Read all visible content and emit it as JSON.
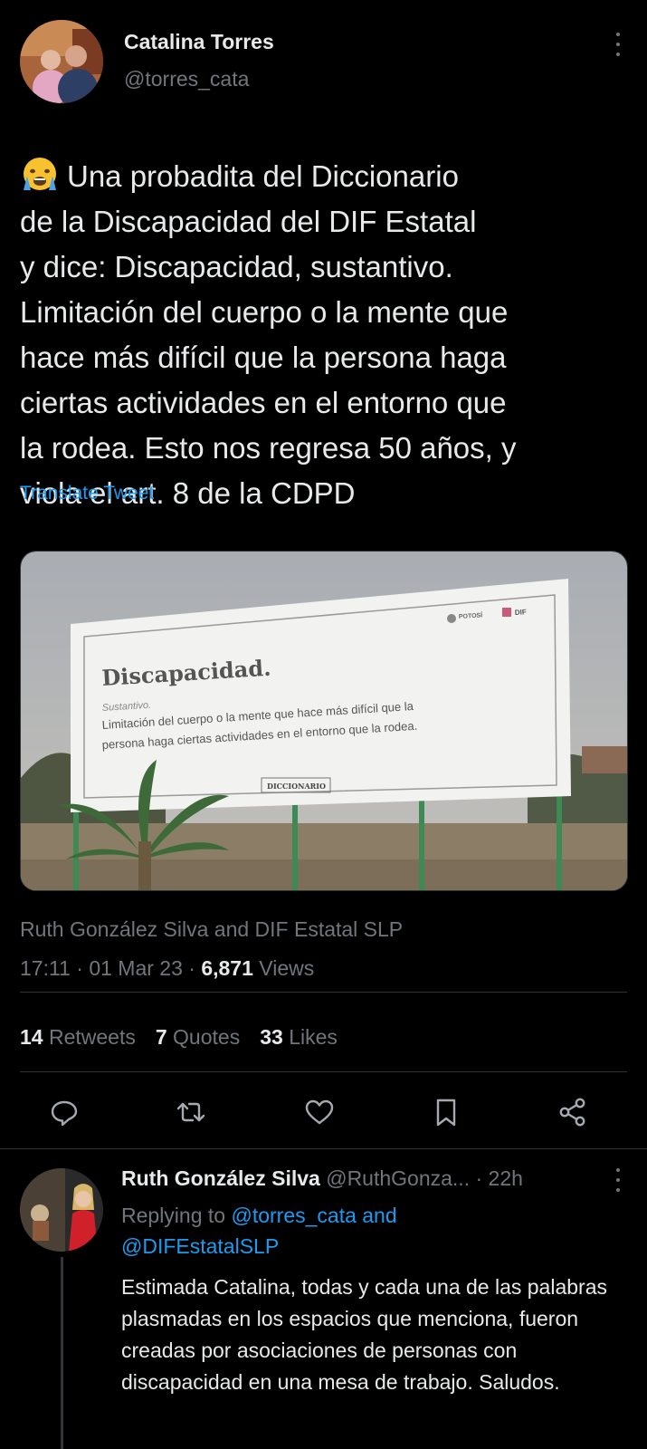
{
  "tweet": {
    "author_name": "Catalina Torres",
    "author_handle": "@torres_cata",
    "text": "Una probadita del Diccionario\nde la Discapacidad del DIF Estatal\ny dice: Discapacidad, sustantivo.\nLimitación del cuerpo o la mente que\nhace más difícil que la persona haga\nciertas actividades en el entorno que\nla rodea.  Esto nos regresa 50 años, y\nviola el art. 8 de la CDPD",
    "translate_label": "Translate Tweet",
    "media": {
      "billboard_title": "Discapacidad.",
      "billboard_pos": "Sustantivo.",
      "billboard_line1": "Limitación del cuerpo o la mente que hace más difícil que la",
      "billboard_line2": "persona haga ciertas actividades en el entorno que la rodea.",
      "billboard_logo1": "POTOSÍ",
      "billboard_logo2": "DIF",
      "billboard_footer": "DICCIONARIO"
    },
    "tagged": "Ruth González Silva and DIF Estatal SLP",
    "time": "17:11",
    "date": "01 Mar 23",
    "views_count": "6,871",
    "views_label": "Views",
    "retweets_count": "14",
    "retweets_label": "Retweets",
    "quotes_count": "7",
    "quotes_label": "Quotes",
    "likes_count": "33",
    "likes_label": "Likes",
    "separator": "·"
  },
  "actions": [
    "reply-icon",
    "retweet-icon",
    "like-icon",
    "bookmark-icon",
    "share-icon"
  ],
  "reply": {
    "author_name": "Ruth González Silva",
    "author_handle": "@RuthGonza...",
    "dot": "·",
    "time": "22h",
    "replying_prefix": "Replying to",
    "replying_to_1": "@torres_cata",
    "replying_and": "and",
    "replying_to_2": "@DIFEstatalSLP",
    "text": "Estimada Catalina, todas y cada una de las palabras plasmadas en los espacios que menciona, fueron creadas por asociaciones de personas con discapacidad en una mesa de trabajo. Saludos."
  },
  "colors": {
    "background": "#000000",
    "text": "#e7e9ea",
    "secondary": "#71767b",
    "accent": "#1d9bf0",
    "divider": "#2f3336"
  }
}
